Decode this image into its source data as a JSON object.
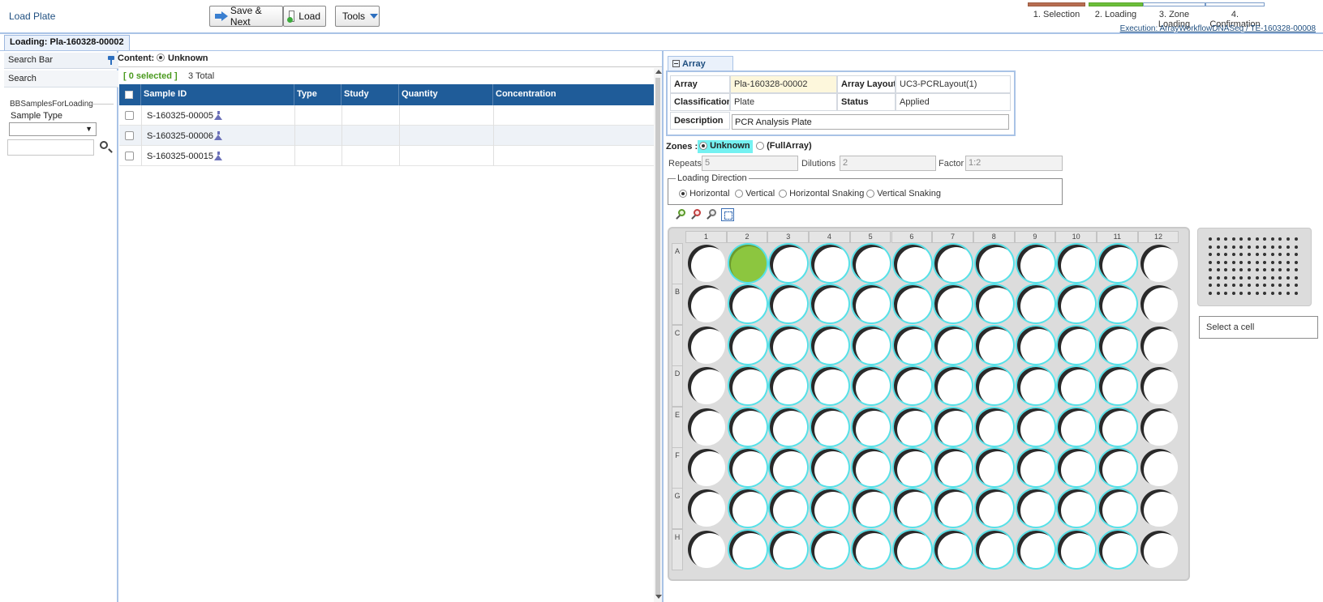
{
  "header": {
    "page_title": "Load Plate",
    "buttons": {
      "save_next": "Save & Next",
      "load": "Load",
      "tools": "Tools"
    },
    "steps": [
      {
        "label": "1. Selection",
        "color": "#b86e52"
      },
      {
        "label": "2. Loading",
        "color": "#6dbf3a"
      },
      {
        "label": "3. Zone Loading",
        "color": "#ffffff"
      },
      {
        "label": "4. Confirmation",
        "color": "#ffffff"
      }
    ],
    "execution": "Execution: ArrayWorkflowDNASeq / TE-160328-00008"
  },
  "tab": {
    "label": "Loading: Pla-160328-00002"
  },
  "sidebar": {
    "title": "Search Bar",
    "search_label": "Search",
    "group_legend": "BBSamplesForLoading",
    "sample_type_label": "Sample Type",
    "sample_type_value": "",
    "search_text": ""
  },
  "samples": {
    "content_label": "Content:",
    "content_value": "Unknown",
    "selected_text": "[ 0 selected ]",
    "total_text": "3 Total",
    "columns": [
      "Sample ID",
      "Type",
      "Study",
      "Quantity",
      "Concentration"
    ],
    "rows": [
      {
        "id": "S-160325-00005",
        "type": "",
        "study": "",
        "quantity": "",
        "concentration": ""
      },
      {
        "id": "S-160325-00006",
        "type": "",
        "study": "",
        "quantity": "",
        "concentration": ""
      },
      {
        "id": "S-160325-00015",
        "type": "",
        "study": "",
        "quantity": "",
        "concentration": ""
      }
    ]
  },
  "array": {
    "tab_label": "Array",
    "fields": {
      "array_label": "Array",
      "array_value": "Pla-160328-00002",
      "layout_label": "Array Layout",
      "layout_value": "UC3-PCRLayout(1)",
      "classification_label": "Classification",
      "classification_value": "Plate",
      "status_label": "Status",
      "status_value": "Applied",
      "description_label": "Description",
      "description_value": "PCR Analysis Plate"
    }
  },
  "zones": {
    "label": "Zones :",
    "options": [
      "Unknown",
      "(FullArray)"
    ],
    "selected": "Unknown",
    "highlight_color": "#74f1f1"
  },
  "repeats": {
    "repeats_label": "Repeats",
    "repeats_value": "5",
    "dilutions_label": "Dilutions",
    "dilutions_value": "2",
    "factor_label": "Factor",
    "factor_value": "1:2"
  },
  "loading_direction": {
    "legend": "Loading Direction",
    "options": [
      "Horizontal",
      "Vertical",
      "Horizontal Snaking",
      "Vertical Snaking"
    ],
    "selected": "Horizontal"
  },
  "plate": {
    "columns": [
      "1",
      "2",
      "3",
      "4",
      "5",
      "6",
      "7",
      "8",
      "9",
      "10",
      "11",
      "12"
    ],
    "rows": [
      "A",
      "B",
      "C",
      "D",
      "E",
      "F",
      "G",
      "H"
    ],
    "filled_wells": [
      "A2"
    ],
    "zone_columns": [
      "2",
      "3",
      "4",
      "5",
      "6",
      "7",
      "8",
      "9",
      "10",
      "11"
    ],
    "filled_color": "#8cc63f",
    "zone_color": "#56e1e8"
  },
  "cell_info": {
    "placeholder": "Select a cell"
  }
}
